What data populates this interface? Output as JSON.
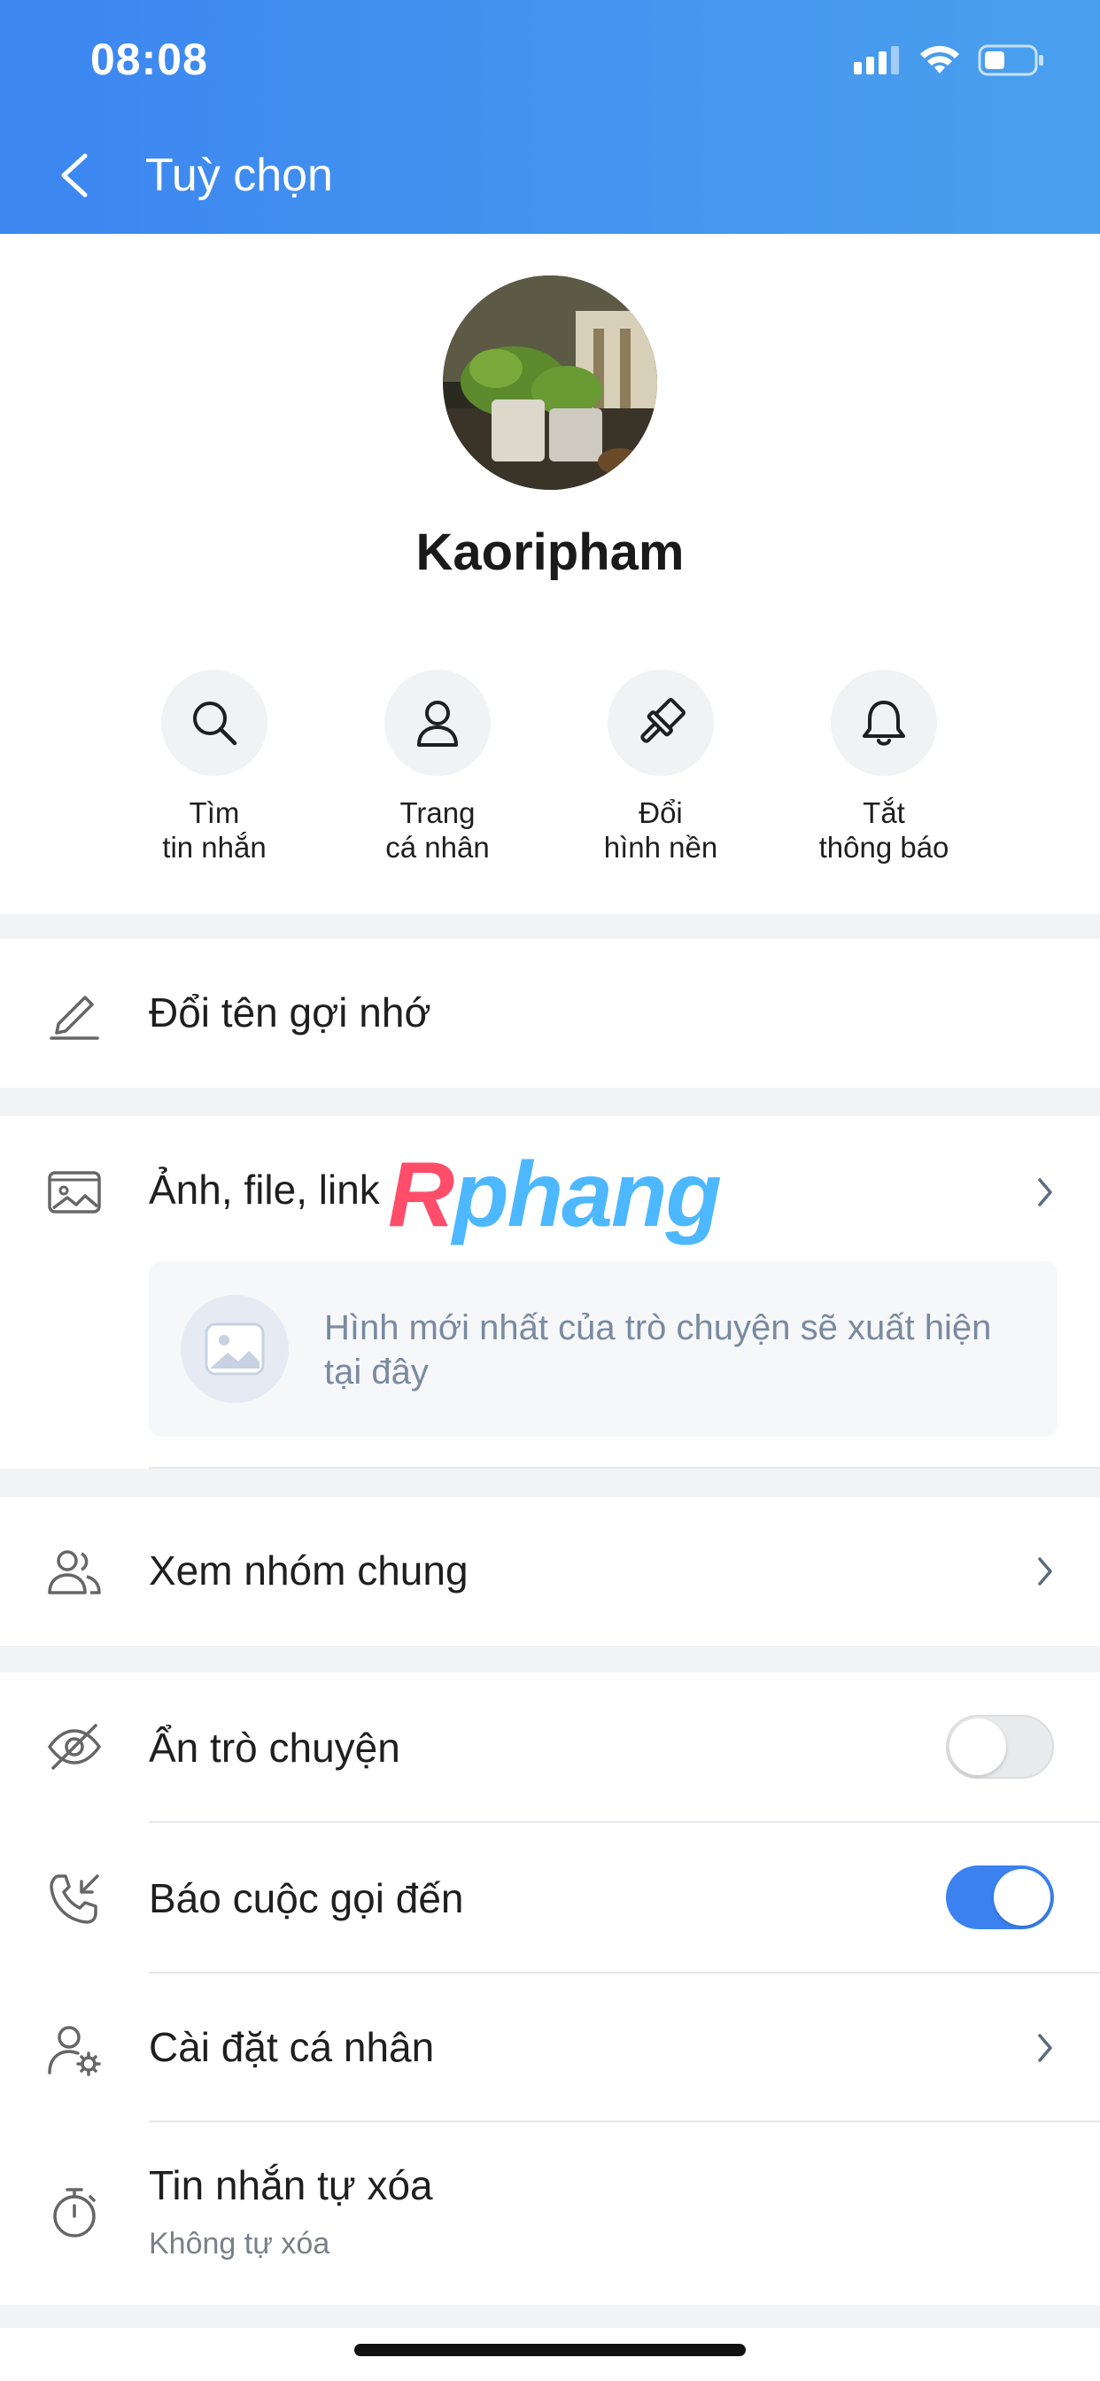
{
  "status_bar": {
    "time": "08:08"
  },
  "header": {
    "title": "Tuỳ chọn"
  },
  "profile": {
    "name": "Kaoripham"
  },
  "actions": [
    {
      "line1": "Tìm",
      "line2": "tin nhắn",
      "icon": "search-icon"
    },
    {
      "line1": "Trang",
      "line2": "cá nhân",
      "icon": "user-icon"
    },
    {
      "line1": "Đổi",
      "line2": "hình nền",
      "icon": "paint-brush-icon"
    },
    {
      "line1": "Tắt",
      "line2": "thông báo",
      "icon": "bell-icon"
    }
  ],
  "menu": {
    "rename": "Đổi tên gợi nhớ",
    "media": "Ảnh, file, link",
    "media_placeholder": "Hình mới nhất của trò chuyện sẽ xuất hiện tại đây",
    "groups": "Xem nhóm chung",
    "hide_chat": "Ẩn trò chuyện",
    "hide_chat_on": false,
    "call_alert": "Báo cuộc gọi đến",
    "call_alert_on": true,
    "personal_settings": "Cài đặt cá nhân",
    "self_delete": "Tin nhắn tự xóa",
    "self_delete_value": "Không tự xóa"
  },
  "watermark": {
    "part1": "R",
    "part2": "phang"
  },
  "colors": {
    "header_blue": "#3c86f0",
    "toggle_on": "#3b82f0",
    "muted_text": "#7a8aa0"
  }
}
